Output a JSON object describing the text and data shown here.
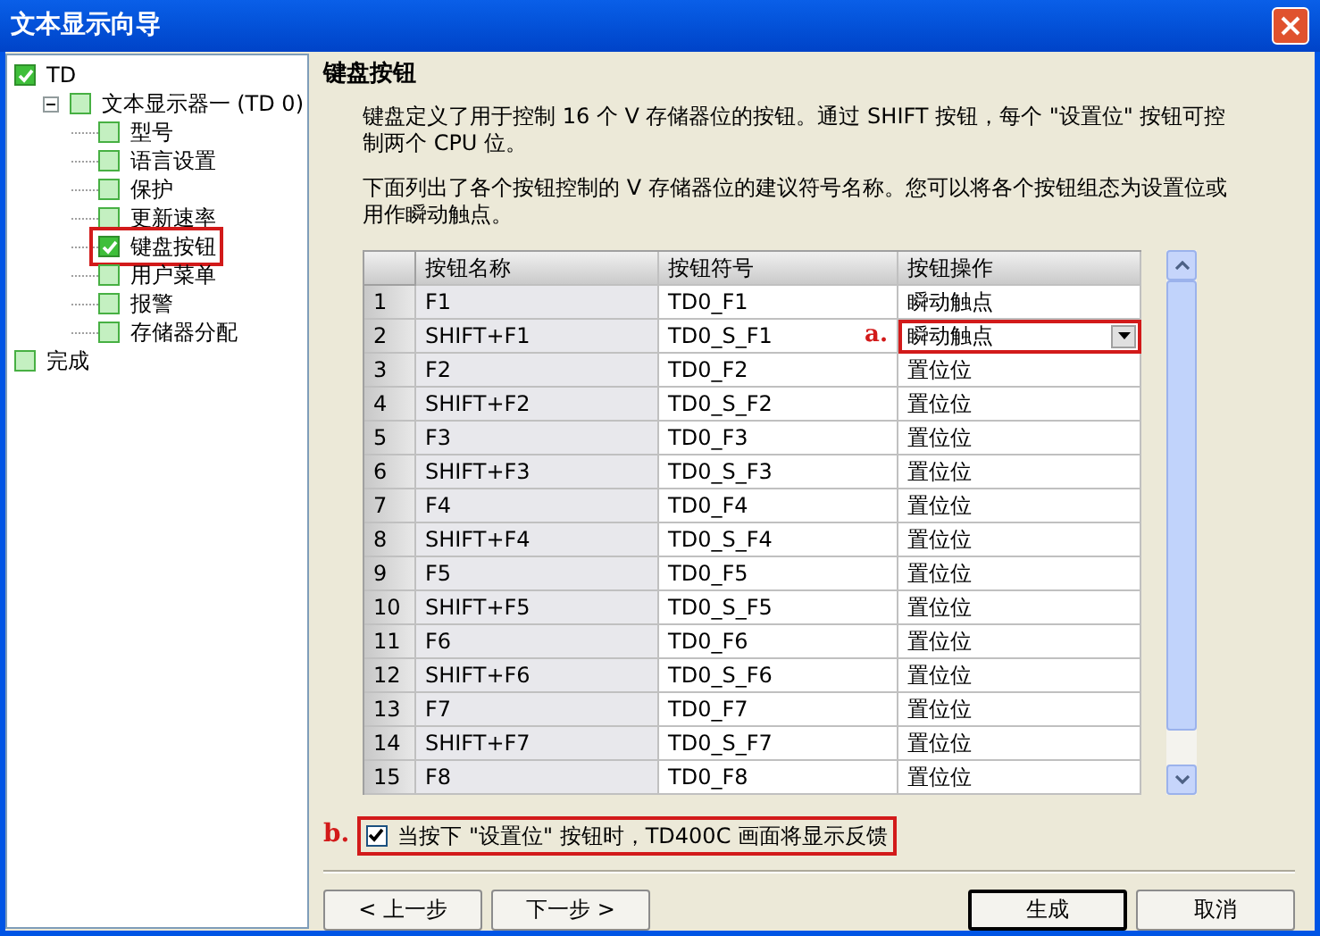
{
  "window": {
    "title": "文本显示向导"
  },
  "tree": [
    {
      "label": "TD",
      "checked": true,
      "annotated": false,
      "children": [
        {
          "label": "文本显示器一 (TD 0)",
          "checked": false,
          "annotated": false,
          "expanded": true,
          "children": [
            {
              "label": "型号",
              "checked": false,
              "annotated": false
            },
            {
              "label": "语言设置",
              "checked": false,
              "annotated": false
            },
            {
              "label": "保护",
              "checked": false,
              "annotated": false
            },
            {
              "label": "更新速率",
              "checked": false,
              "annotated": false
            },
            {
              "label": "键盘按钮",
              "checked": true,
              "annotated": true
            },
            {
              "label": "用户菜单",
              "checked": false,
              "annotated": false
            },
            {
              "label": "报警",
              "checked": false,
              "annotated": false
            },
            {
              "label": "存储器分配",
              "checked": false,
              "annotated": false
            }
          ]
        }
      ]
    },
    {
      "label": "完成",
      "checked": false,
      "annotated": false
    }
  ],
  "page": {
    "heading": "键盘按钮",
    "paragraphs": [
      "键盘定义了用于控制 16 个 V 存储器位的按钮。通过 SHIFT 按钮，每个 \"设置位\" 按钮可控制两个 CPU 位。",
      "下面列出了各个按钮控制的 V 存储器位的建议符号名称。您可以将各个按钮组态为设置位或用作瞬动触点。"
    ]
  },
  "table": {
    "columns": [
      "按钮名称",
      "按钮符号",
      "按钮操作"
    ],
    "rows": [
      {
        "num": "1",
        "name": "F1",
        "symbol": "TD0_F1",
        "operation": "瞬动触点",
        "kind": "text"
      },
      {
        "num": "2",
        "name": "SHIFT+F1",
        "symbol": "TD0_S_F1",
        "operation": "瞬动触点",
        "kind": "dropdown",
        "annotation": "a."
      },
      {
        "num": "3",
        "name": "F2",
        "symbol": "TD0_F2",
        "operation": "置位位",
        "kind": "text"
      },
      {
        "num": "4",
        "name": "SHIFT+F2",
        "symbol": "TD0_S_F2",
        "operation": "置位位",
        "kind": "text"
      },
      {
        "num": "5",
        "name": "F3",
        "symbol": "TD0_F3",
        "operation": "置位位",
        "kind": "text"
      },
      {
        "num": "6",
        "name": "SHIFT+F3",
        "symbol": "TD0_S_F3",
        "operation": "置位位",
        "kind": "text"
      },
      {
        "num": "7",
        "name": "F4",
        "symbol": "TD0_F4",
        "operation": "置位位",
        "kind": "text"
      },
      {
        "num": "8",
        "name": "SHIFT+F4",
        "symbol": "TD0_S_F4",
        "operation": "置位位",
        "kind": "text"
      },
      {
        "num": "9",
        "name": "F5",
        "symbol": "TD0_F5",
        "operation": "置位位",
        "kind": "text"
      },
      {
        "num": "10",
        "name": "SHIFT+F5",
        "symbol": "TD0_S_F5",
        "operation": "置位位",
        "kind": "text"
      },
      {
        "num": "11",
        "name": "F6",
        "symbol": "TD0_F6",
        "operation": "置位位",
        "kind": "text"
      },
      {
        "num": "12",
        "name": "SHIFT+F6",
        "symbol": "TD0_S_F6",
        "operation": "置位位",
        "kind": "text"
      },
      {
        "num": "13",
        "name": "F7",
        "symbol": "TD0_F7",
        "operation": "置位位",
        "kind": "text"
      },
      {
        "num": "14",
        "name": "SHIFT+F7",
        "symbol": "TD0_S_F7",
        "operation": "置位位",
        "kind": "text"
      },
      {
        "num": "15",
        "name": "F8",
        "symbol": "TD0_F8",
        "operation": "置位位",
        "kind": "text"
      }
    ]
  },
  "option": {
    "annotation": "b.",
    "label": "当按下 \"设置位\" 按钮时，TD400C 画面将显示反馈",
    "checked": true
  },
  "buttons": [
    {
      "label": "< 上一步",
      "default": false
    },
    {
      "label": "下一步 >",
      "default": false
    },
    {
      "label": "生成",
      "default": true
    },
    {
      "label": "取消",
      "default": false
    }
  ]
}
